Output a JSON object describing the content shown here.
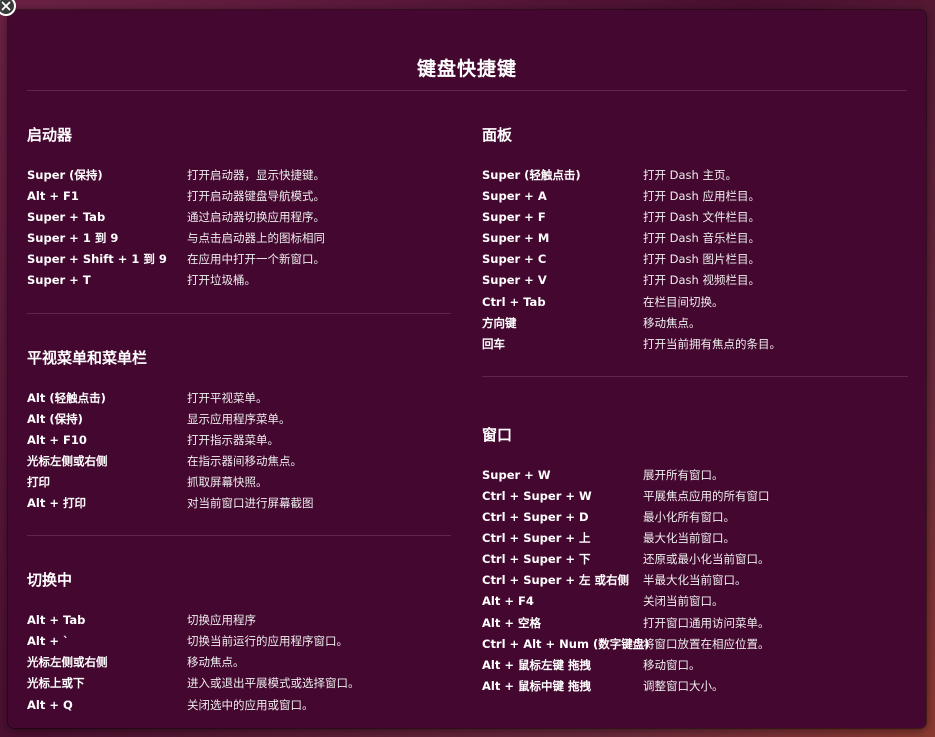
{
  "title": "键盘快捷键",
  "left_sections": [
    {
      "heading": "启动器",
      "rows": [
        {
          "key": "Super (保持)",
          "desc": "打开启动器，显示快捷键。"
        },
        {
          "key": "Alt + F1",
          "desc": "打开启动器键盘导航模式。"
        },
        {
          "key": "Super + Tab",
          "desc": "通过启动器切换应用程序。"
        },
        {
          "key": "Super + 1 到 9",
          "desc": "与点击启动器上的图标相同"
        },
        {
          "key": "Super + Shift + 1 到 9",
          "desc": "在应用中打开一个新窗口。"
        },
        {
          "key": "Super + T",
          "desc": "打开垃圾桶。"
        }
      ]
    },
    {
      "heading": "平视菜单和菜单栏",
      "rows": [
        {
          "key": "Alt (轻触点击)",
          "desc": "打开平视菜单。"
        },
        {
          "key": "Alt (保持)",
          "desc": "显示应用程序菜单。"
        },
        {
          "key": "Alt + F10",
          "desc": "打开指示器菜单。"
        },
        {
          "key": "光标左侧或右侧",
          "desc": "在指示器间移动焦点。"
        },
        {
          "key": "打印",
          "desc": "抓取屏幕快照。"
        },
        {
          "key": "Alt + 打印",
          "desc": "对当前窗口进行屏幕截图"
        }
      ]
    },
    {
      "heading": "切换中",
      "rows": [
        {
          "key": "Alt + Tab",
          "desc": "切换应用程序"
        },
        {
          "key": "Alt + `",
          "desc": "切换当前运行的应用程序窗口。"
        },
        {
          "key": "光标左侧或右侧",
          "desc": "移动焦点。"
        },
        {
          "key": "光标上或下",
          "desc": "进入或退出平展模式或选择窗口。"
        },
        {
          "key": "Alt + Q",
          "desc": "关闭选中的应用或窗口。"
        }
      ]
    }
  ],
  "right_sections": [
    {
      "heading": "面板",
      "rows": [
        {
          "key": "Super (轻触点击)",
          "desc": "打开 Dash 主页。"
        },
        {
          "key": "Super + A",
          "desc": "打开 Dash 应用栏目。"
        },
        {
          "key": "Super + F",
          "desc": "打开 Dash 文件栏目。"
        },
        {
          "key": "Super + M",
          "desc": "打开 Dash 音乐栏目。"
        },
        {
          "key": "Super + C",
          "desc": "打开 Dash 图片栏目。"
        },
        {
          "key": "Super + V",
          "desc": "打开 Dash 视频栏目。"
        },
        {
          "key": "Ctrl + Tab",
          "desc": "在栏目间切换。"
        },
        {
          "key": "方向键",
          "desc": "移动焦点。"
        },
        {
          "key": "回车",
          "desc": "打开当前拥有焦点的条目。"
        }
      ]
    },
    {
      "heading": "窗口",
      "rows": [
        {
          "key": "Super + W",
          "desc": "展开所有窗口。"
        },
        {
          "key": "Ctrl + Super + W",
          "desc": "平展焦点应用的所有窗口"
        },
        {
          "key": "Ctrl + Super + D",
          "desc": "最小化所有窗口。"
        },
        {
          "key": "Ctrl + Super + 上",
          "desc": "最大化当前窗口。"
        },
        {
          "key": "Ctrl + Super + 下",
          "desc": "还原或最小化当前窗口。"
        },
        {
          "key": "Ctrl + Super + 左 或右侧",
          "desc": "半最大化当前窗口。"
        },
        {
          "key": "Alt + F4",
          "desc": "关闭当前窗口。"
        },
        {
          "key": "Alt + 空格",
          "desc": "打开窗口通用访问菜单。"
        },
        {
          "key": "Ctrl + Alt + Num (数字键盘)",
          "desc": "将窗口放置在相应位置。"
        },
        {
          "key": "Alt + 鼠标左键 拖拽",
          "desc": "移动窗口。"
        },
        {
          "key": "Alt + 鼠标中键 拖拽",
          "desc": "调整窗口大小。"
        }
      ]
    }
  ],
  "icons": {
    "close": "close-icon"
  },
  "colors": {
    "panel_bg": "#44072f",
    "text": "#ffffff"
  }
}
